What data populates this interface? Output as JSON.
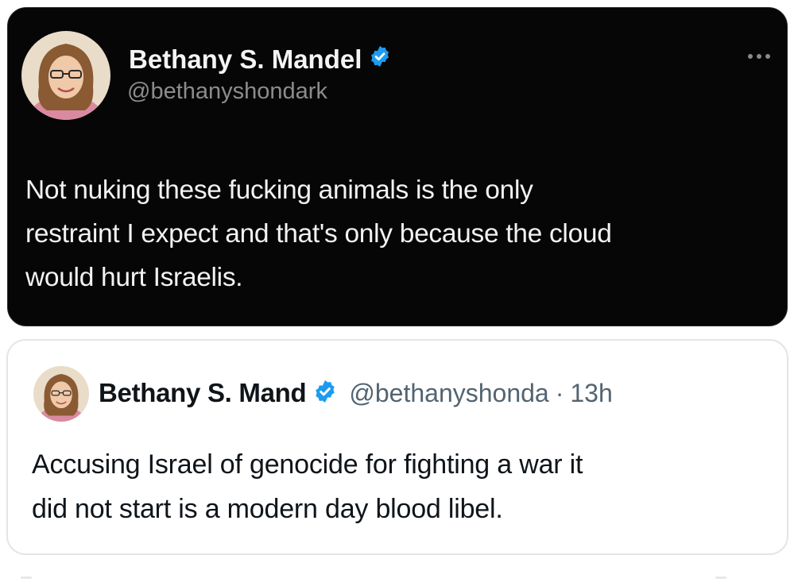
{
  "main_tweet": {
    "author_name": "Bethany S. Mandel",
    "author_handle": "@bethanyshondark",
    "text": "Not nuking these fucking animals is the only\nrestraint I expect and that's only because the cloud\nwould hurt Israelis.",
    "avatar_icon": "profile-photo",
    "verified_icon": "verified-badge-icon",
    "more_icon": "more-options-icon"
  },
  "quoted_tweet": {
    "author_name": "Bethany S. Mand",
    "author_handle": "@bethanyshonda",
    "separator": "·",
    "time": "13h",
    "text": "Accusing Israel of genocide for fighting a war it\ndid not start is a modern day blood libel.",
    "avatar_icon": "profile-photo",
    "verified_icon": "verified-badge-icon"
  },
  "colors": {
    "dark_card_bg": "#060606",
    "light_card_border": "#e3e6e8",
    "verified_blue": "#1d9bf0",
    "secondary_text": "#536471"
  }
}
